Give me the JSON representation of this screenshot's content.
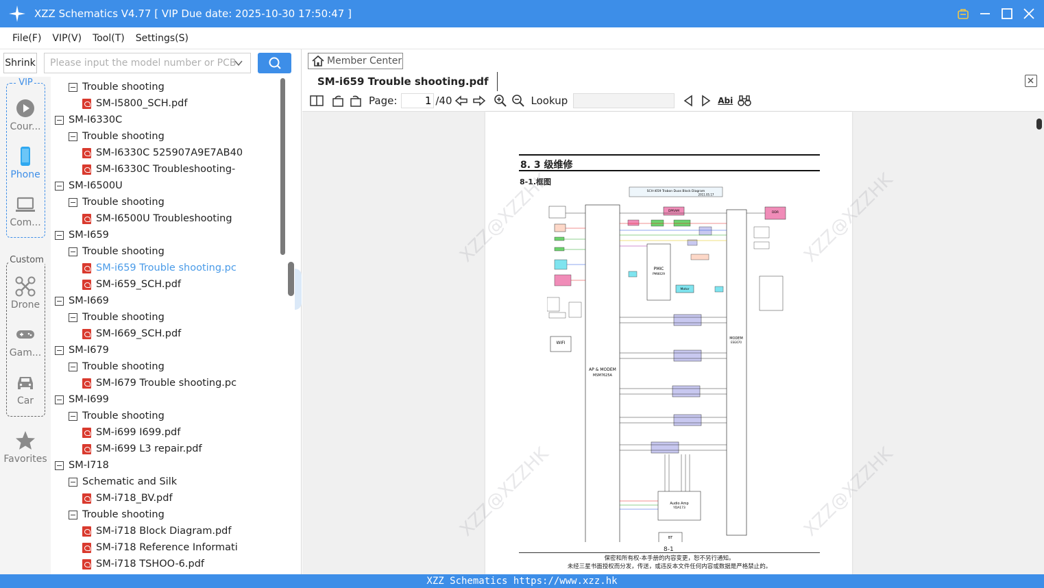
{
  "window": {
    "title": "XZZ Schematics V4.77 [ VIP Due date: 2025-10-30 17:50:47 ]"
  },
  "menu": [
    "File(F)",
    "VIP(V)",
    "Tool(T)",
    "Settings(S)"
  ],
  "search": {
    "shrink_label": "Shrink",
    "placeholder": "Please input the model number or PCB"
  },
  "rail": {
    "vip_group_label": "VIP",
    "custom_group_label": "Custom",
    "items": [
      {
        "label": "Cour...",
        "icon": "play-icon"
      },
      {
        "label": "Phone",
        "icon": "phone-icon"
      },
      {
        "label": "Com...",
        "icon": "laptop-icon"
      },
      {
        "label": "Drone",
        "icon": "drone-icon"
      },
      {
        "label": "Gam...",
        "icon": "gamepad-icon"
      },
      {
        "label": "Car",
        "icon": "car-icon"
      },
      {
        "label": "Favorites",
        "icon": "star-icon"
      }
    ]
  },
  "tree": [
    {
      "label": "Trouble shooting",
      "type": "folder",
      "level": 1
    },
    {
      "label": "SM-I5800_SCH.pdf",
      "type": "pdf",
      "level": 2
    },
    {
      "label": "SM-I6330C",
      "type": "folder",
      "level": 0
    },
    {
      "label": "Trouble shooting",
      "type": "folder",
      "level": 1
    },
    {
      "label": "SM-I6330C 525907A9E7AB40",
      "type": "pdf",
      "level": 2
    },
    {
      "label": "SM-I6330C Troubleshooting-",
      "type": "pdf",
      "level": 2
    },
    {
      "label": "SM-I6500U",
      "type": "folder",
      "level": 0
    },
    {
      "label": "Trouble shooting",
      "type": "folder",
      "level": 1
    },
    {
      "label": "SM-I6500U Troubleshooting",
      "type": "pdf",
      "level": 2
    },
    {
      "label": "SM-I659",
      "type": "folder",
      "level": 0
    },
    {
      "label": "Trouble shooting",
      "type": "folder",
      "level": 1
    },
    {
      "label": "SM-i659 Trouble shooting.pc",
      "type": "pdf",
      "level": 2,
      "selected": true
    },
    {
      "label": "SM-i659_SCH.pdf",
      "type": "pdf",
      "level": 2
    },
    {
      "label": "SM-I669",
      "type": "folder",
      "level": 0
    },
    {
      "label": "Trouble shooting",
      "type": "folder",
      "level": 1
    },
    {
      "label": "SM-I669_SCH.pdf",
      "type": "pdf",
      "level": 2
    },
    {
      "label": "SM-I679",
      "type": "folder",
      "level": 0
    },
    {
      "label": "Trouble shooting",
      "type": "folder",
      "level": 1
    },
    {
      "label": "SM-I679 Trouble shooting.pc",
      "type": "pdf",
      "level": 2
    },
    {
      "label": "SM-I699",
      "type": "folder",
      "level": 0
    },
    {
      "label": "Trouble shooting",
      "type": "folder",
      "level": 1
    },
    {
      "label": "SM-i699 I699.pdf",
      "type": "pdf",
      "level": 2
    },
    {
      "label": "SM-i699 L3 repair.pdf",
      "type": "pdf",
      "level": 2
    },
    {
      "label": "SM-I718",
      "type": "folder",
      "level": 0
    },
    {
      "label": "Schematic and Silk",
      "type": "folder",
      "level": 1
    },
    {
      "label": "SM-i718_BV.pdf",
      "type": "pdf",
      "level": 2
    },
    {
      "label": "Trouble shooting",
      "type": "folder",
      "level": 1
    },
    {
      "label": "SM-i718 Block Diagram.pdf",
      "type": "pdf",
      "level": 2
    },
    {
      "label": "SM-i718 Reference Informati",
      "type": "pdf",
      "level": 2
    },
    {
      "label": "SM-i718 TSHOO-6.pdf",
      "type": "pdf",
      "level": 2
    }
  ],
  "viewer": {
    "member_center_label": "Member Center",
    "tab_title": "SM-i659 Trouble shooting.pdf",
    "page_label": "Page:",
    "page_current": "1",
    "page_total": "/40",
    "lookup_label": "Lookup",
    "abi_label": "Abi"
  },
  "document": {
    "heading": "8. 3 级维修",
    "subheading": "8-1.框图",
    "page_number": "8-1",
    "footer_line1": "保密和所有权-本手册的内容变更，恕不另行通知。",
    "footer_line2": "未经三星书面授权而分发，传送，或违反本文件任何内容或数据是严格禁止的。",
    "watermark": "XZZ@XZZHK",
    "diagram": {
      "title": "SCH-i659 Trabon Duos Block Diagram",
      "date": "2011.05.17",
      "blocks": [
        "AP & MODEM",
        "MSM7625A",
        "MODEM",
        "ESG670",
        "PMIC",
        "PM8029",
        "Motor",
        "WIFI",
        "BT",
        "Audio Amp",
        "YDA173",
        "DDR",
        "DPRAM"
      ]
    }
  },
  "status": {
    "text": "XZZ Schematics https://www.xzz.hk"
  },
  "colors": {
    "accent": "#3d8ee8",
    "pdf_icon": "#d93a2e",
    "selected_text": "#4a9be8"
  }
}
